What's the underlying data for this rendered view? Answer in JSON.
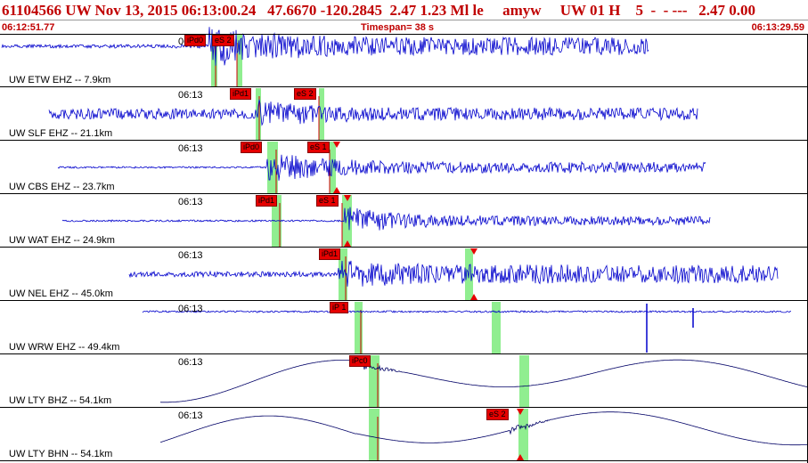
{
  "header": {
    "title": "61104566 UW Nov 13, 2015 06:13:00.24   47.6670 -120.2845  2.47 1.23 Ml le     amyw     UW 01 H    5  -  - ---   2.47 0.00",
    "start_time": "06:12:51.77",
    "timespan": "Timespan=  38 s",
    "end_time": "06:13:29.59"
  },
  "colors": {
    "header_text": "#c00000",
    "trace": "#0000cc",
    "pick": "#e60000",
    "window": "#90ee90"
  },
  "panels": [
    {
      "label": "UW ETW EHZ -- 7.9km",
      "time": "06:13",
      "picks": [
        "iPd0",
        "eS 2"
      ]
    },
    {
      "label": "UW SLF EHZ -- 21.1km",
      "time": "06:13",
      "picks": [
        "iPd1",
        "eS 2"
      ]
    },
    {
      "label": "UW CBS EHZ -- 23.7km",
      "time": "06:13",
      "picks": [
        "iPd0",
        "eS 1"
      ]
    },
    {
      "label": "UW WAT EHZ -- 24.9km",
      "time": "06:13",
      "picks": [
        "iPd1",
        "eS 1"
      ]
    },
    {
      "label": "UW NEL EHZ -- 45.0km",
      "time": "06:13",
      "picks": [
        "iPd1"
      ]
    },
    {
      "label": "UW WRW EHZ -- 49.4km",
      "time": "06:13",
      "picks": [
        "iP 1"
      ]
    },
    {
      "label": "UW LTY BHZ -- 54.1km",
      "time": "06:13",
      "picks": [
        "iPc0"
      ]
    },
    {
      "label": "UW LTY BHN -- 54.1km",
      "time": "06:13",
      "picks": [
        "eS 2"
      ]
    }
  ]
}
